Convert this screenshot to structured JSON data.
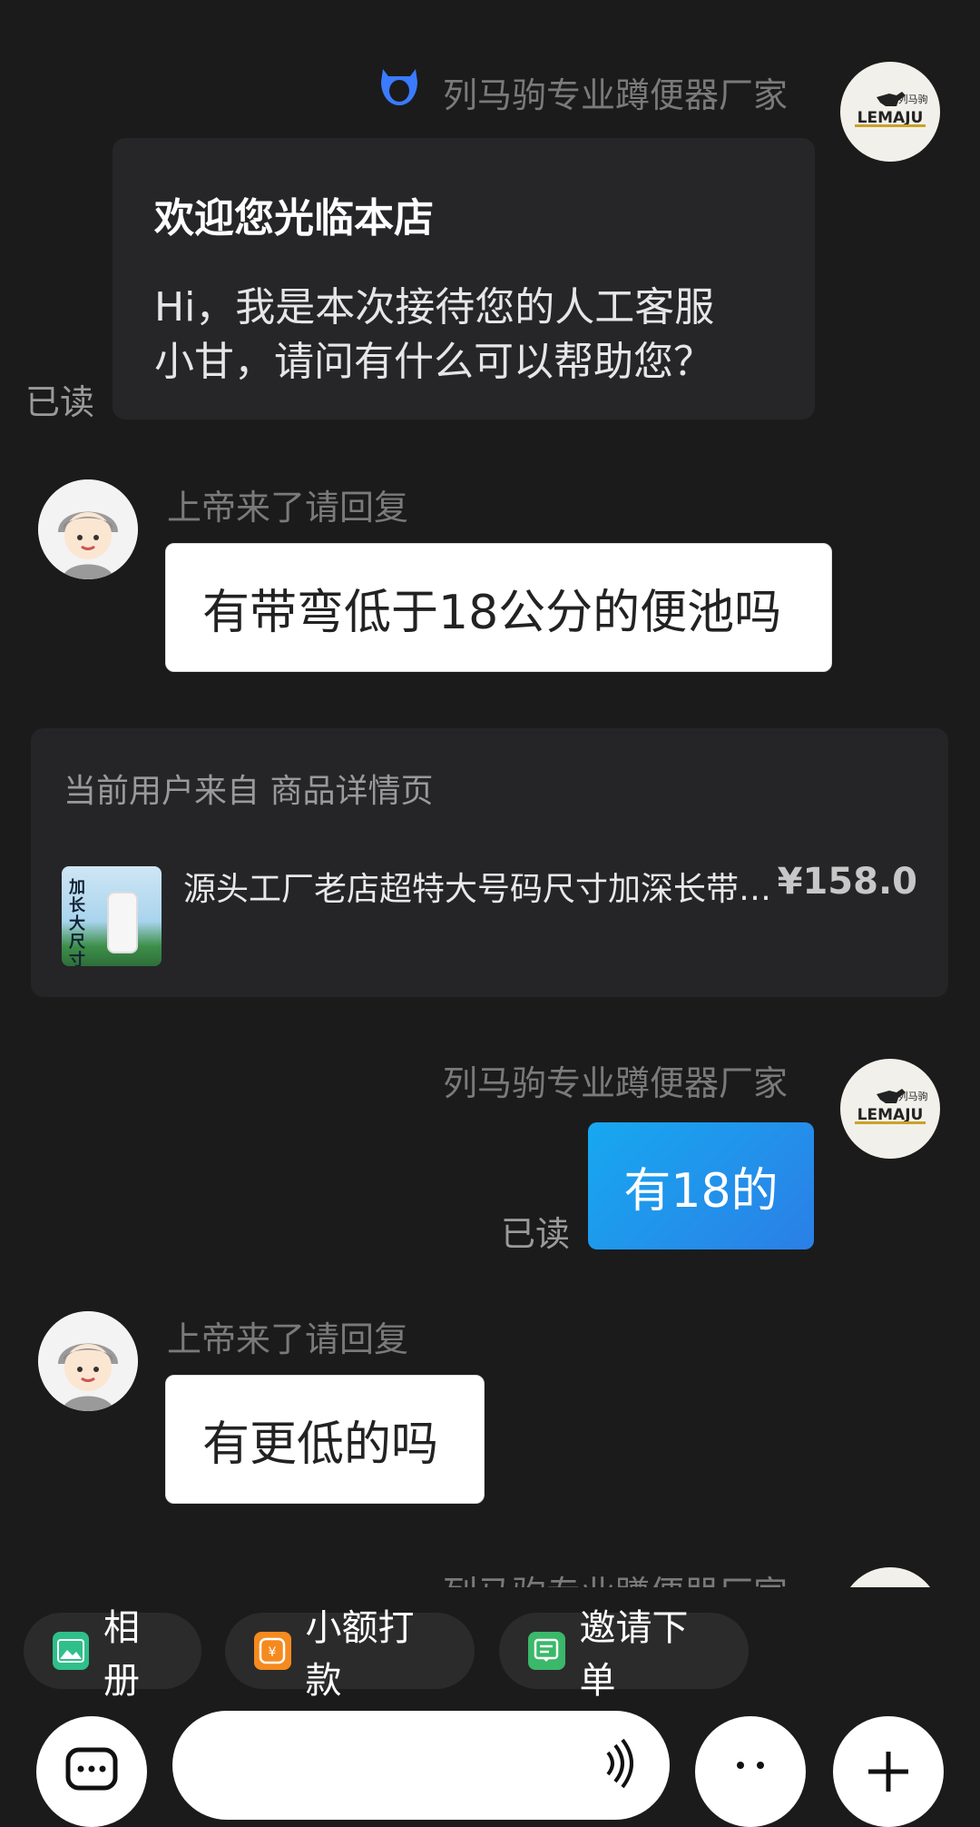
{
  "messages": {
    "shop_name_1": "列马驹专业蹲便器厂家",
    "welcome_title": "欢迎您光临本店",
    "welcome_body_1": "Hi，我是本次接待您的人工客服",
    "welcome_body_2": "小甘，请问有什么可以帮助您？",
    "read_1": "已读",
    "user_name_1": "上帝来了请回复",
    "user_msg_1": "有带弯低于18公分的便池吗",
    "source_label": "当前用户来自 商品详情页",
    "product_title": "源头工厂老店超特大号码尺寸加深长带…",
    "product_price": "¥158.0",
    "product_thumb_text": "加长大尺寸",
    "shop_name_2": "列马驹专业蹲便器厂家",
    "shop_msg_1": "有18的",
    "read_2": "已读",
    "user_name_2": "上帝来了请回复",
    "user_msg_2": "有更低的吗",
    "shop_name_3": "列马驹专业蹲便器厂家"
  },
  "shop_logo": {
    "brand": "LEMAJU",
    "cn": "列马驹"
  },
  "quick_actions": [
    {
      "label": "相册",
      "icon": "album-icon",
      "color": "#2fbf8a"
    },
    {
      "label": "小额打款",
      "icon": "payment-icon",
      "color": "#f58a1f"
    },
    {
      "label": "邀请下单",
      "icon": "order-invite-icon",
      "color": "#3bb86a"
    }
  ],
  "colors": {
    "accent_blue": "#1f8fe8",
    "shop_badge": "#3a7bff"
  }
}
